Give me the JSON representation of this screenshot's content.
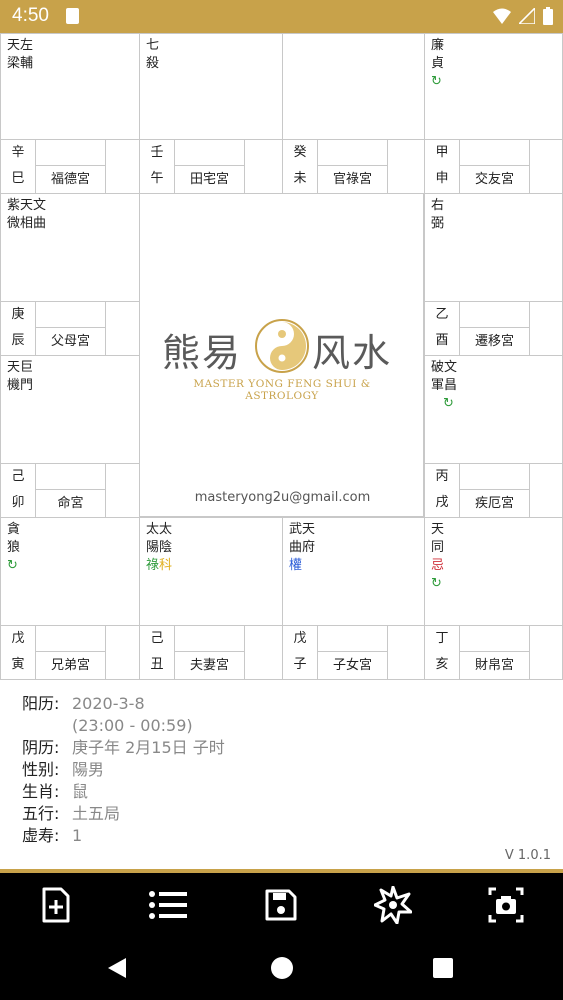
{
  "status_bar": {
    "time": "4:50"
  },
  "palaces": [
    {
      "stars": "天左\n梁輔",
      "stem": "辛",
      "branch": "巳",
      "palace": "福德宮",
      "marks": []
    },
    {
      "stars": "七\n殺",
      "stem": "壬",
      "branch": "午",
      "palace": "田宅宮",
      "marks": []
    },
    {
      "stars": "",
      "stem": "癸",
      "branch": "未",
      "palace": "官祿宮",
      "marks": []
    },
    {
      "stars": "廉\n貞",
      "stem": "甲",
      "branch": "申",
      "palace": "交友宮",
      "marks": [
        "↻"
      ]
    },
    {
      "stars": "紫天文\n微相曲",
      "stem": "庚",
      "branch": "辰",
      "palace": "父母宮",
      "marks": []
    },
    {
      "stars": "右\n弼",
      "stem": "乙",
      "branch": "酉",
      "palace": "遷移宮",
      "marks": []
    },
    {
      "stars": "天巨\n機門",
      "stem": "己",
      "branch": "卯",
      "palace": "命宮",
      "marks": []
    },
    {
      "stars": "破文\n軍昌",
      "stem": "丙",
      "branch": "戌",
      "palace": "疾厄宮",
      "marks": [
        "↻"
      ]
    },
    {
      "stars": "貪\n狼",
      "stem": "戊",
      "branch": "寅",
      "palace": "兄弟宮",
      "marks": [
        "↻"
      ]
    },
    {
      "stars": "太太\n陽陰",
      "stem": "己",
      "branch": "丑",
      "palace": "夫妻宮",
      "marks": [
        "祿",
        "科"
      ]
    },
    {
      "stars": "武天\n曲府",
      "stem": "戊",
      "branch": "子",
      "palace": "子女宮",
      "marks": [
        "權"
      ]
    },
    {
      "stars": "天\n同",
      "stem": "丁",
      "branch": "亥",
      "palace": "財帛宮",
      "marks": [
        "忌",
        "↻"
      ]
    }
  ],
  "mark_colors": {
    "↻": "#2e9b3a",
    "祿": "#2e9b3a",
    "科": "#e0b020",
    "權": "#2a5bd7",
    "忌": "#d0303a"
  },
  "center": {
    "logo_cn_left": "熊易",
    "logo_cn_right": "风水",
    "logo_en": "MASTER YONG FENG SHUI & ASTROLOGY",
    "email": "masteryong2u@gmail.com"
  },
  "info": [
    {
      "label": "阳历:",
      "value": "2020-3-8"
    },
    {
      "label": "",
      "value": "(23:00 - 00:59)"
    },
    {
      "label": "阴历:",
      "value": "庚子年 2月15日 子时"
    },
    {
      "label": "性别:",
      "value": "陽男"
    },
    {
      "label": "生肖:",
      "value": "鼠"
    },
    {
      "label": "五行:",
      "value": "土五局"
    },
    {
      "label": "虚寿:",
      "value": "1"
    }
  ],
  "version": "V 1.0.1",
  "toolbar": [
    "new-file-icon",
    "list-icon",
    "save-icon",
    "star-burst-icon",
    "screenshot-icon"
  ],
  "navbar": [
    "back-icon",
    "home-icon",
    "recents-icon"
  ]
}
